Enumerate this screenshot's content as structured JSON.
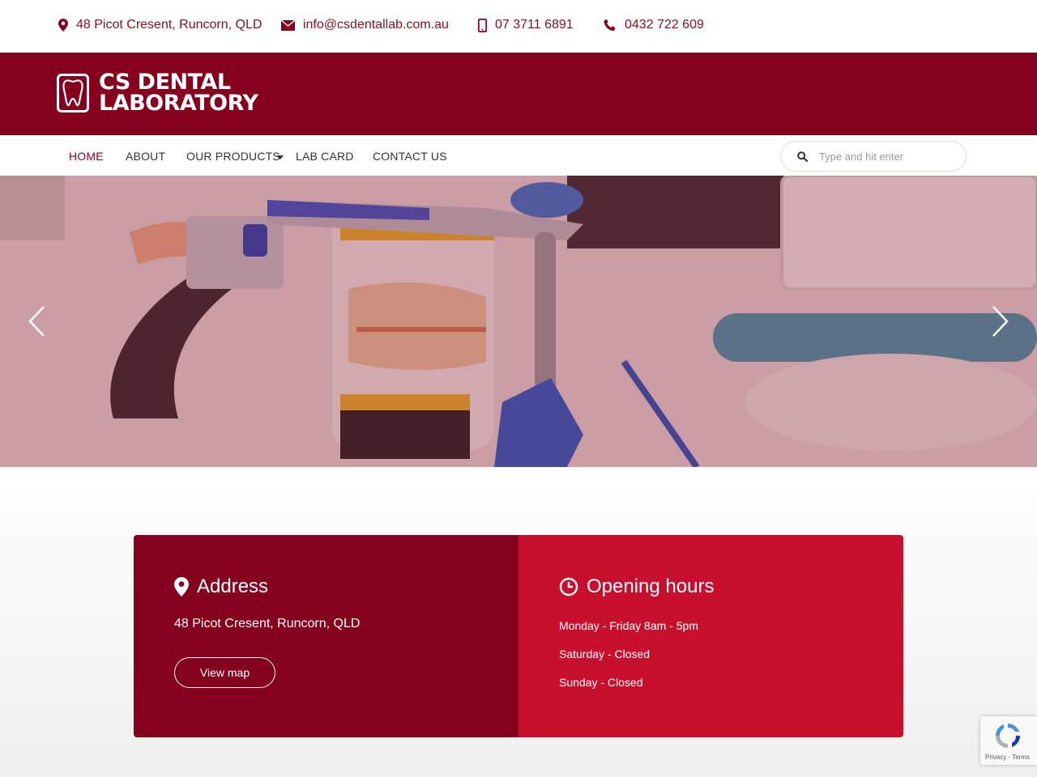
{
  "topbar": {
    "address": "48 Picot Cresent, Runcorn, QLD",
    "email": "info@csdentallab.com.au",
    "phone": "07 3711 6891",
    "mobile": "0432 722 609",
    "icons": [
      "map-marker-icon",
      "envelope-icon",
      "mobile-phone-icon",
      "phone-icon"
    ]
  },
  "brand": {
    "line1": "CS DENTAL",
    "line2": "LABORATORY"
  },
  "nav": {
    "items": [
      {
        "label": "HOME",
        "active": true
      },
      {
        "label": "ABOUT"
      },
      {
        "label": "OUR PRODUCTS",
        "has_dropdown": true
      },
      {
        "label": "LAB CARD"
      },
      {
        "label": "CONTACT US"
      }
    ],
    "search_placeholder": "Type and hit enter"
  },
  "hero": {
    "slider_icons": [
      "chevron-left-icon",
      "chevron-right-icon"
    ]
  },
  "address_panel": {
    "title": "Address",
    "text": "48 Picot Cresent, Runcorn, QLD",
    "button": "View map"
  },
  "hours_panel": {
    "title": "Opening hours",
    "lines": [
      "Monday - Friday 8am - 5pm",
      "Saturday - Closed",
      "Sunday - Closed"
    ]
  },
  "recaptcha": {
    "links": "Privacy - Terms"
  },
  "colors": {
    "brand": "#85001d",
    "accent": "#c8102e"
  }
}
